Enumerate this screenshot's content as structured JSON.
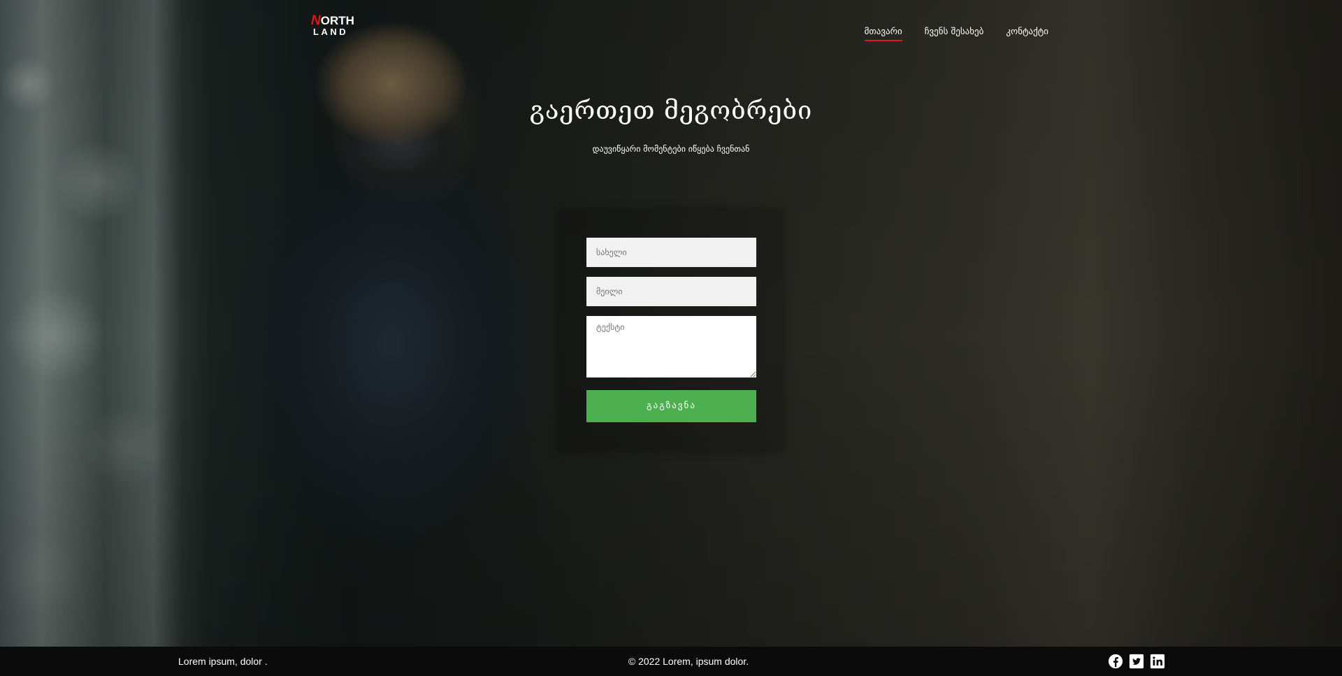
{
  "brand": {
    "logo_first_letter": "N",
    "logo_top_rest": "ORTH",
    "logo_bottom": "LAND",
    "accent_color": "#e3141b"
  },
  "nav": {
    "items": [
      {
        "label": "მთავარი",
        "active": true
      },
      {
        "label": "ჩვენს შესახებ",
        "active": false
      },
      {
        "label": "კონტაქტი",
        "active": false
      }
    ]
  },
  "hero": {
    "title": "გაერთეთ მეგობრები",
    "subtitle": "დაუვიწყარი მომენტები იწყება ჩვენთან"
  },
  "form": {
    "name_placeholder": "სახელი",
    "email_placeholder": "მეილი",
    "message_placeholder": "ტექსტი",
    "submit_label": "გაგზავნა",
    "submit_color": "#4caf50"
  },
  "footer": {
    "left_text": "Lorem ipsum, dolor .",
    "center_text": "© 2022 Lorem, ipsum dolor.",
    "social_icons": [
      "facebook-icon",
      "twitter-icon",
      "linkedin-icon"
    ]
  }
}
